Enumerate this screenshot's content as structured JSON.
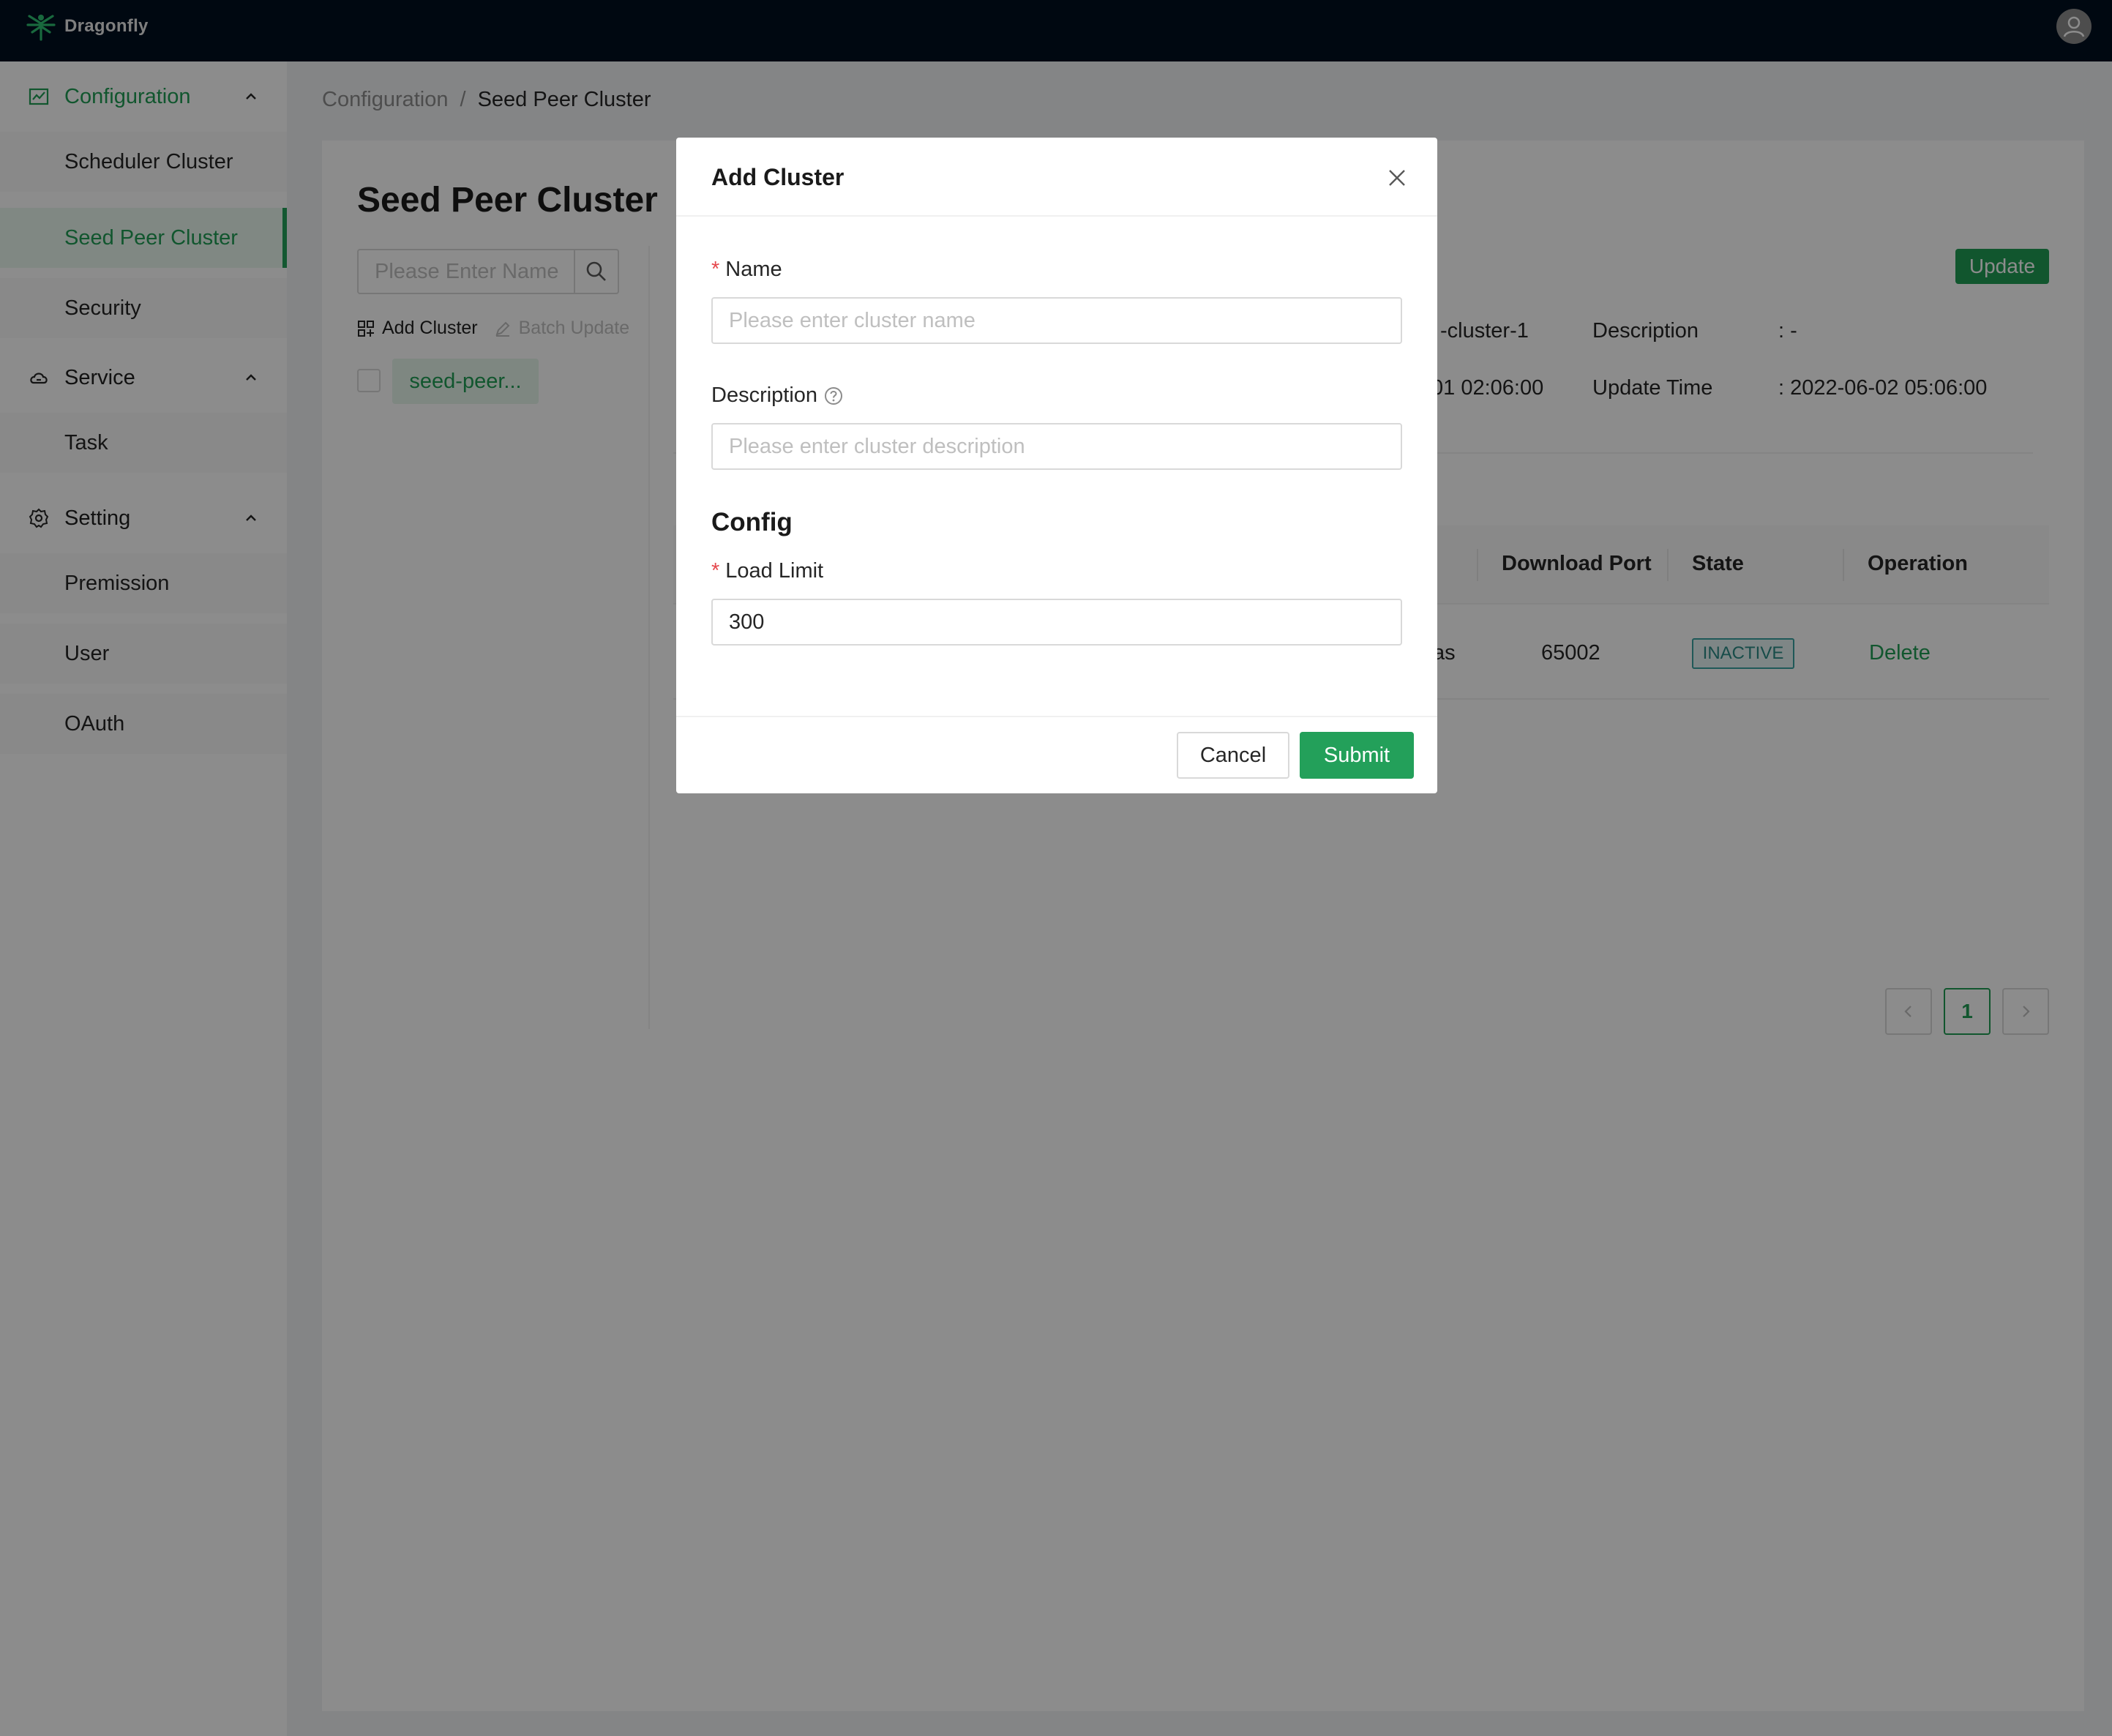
{
  "app": {
    "name": "Dragonfly"
  },
  "sidebar": {
    "groups": [
      {
        "label": "Configuration",
        "icon": "chart-icon",
        "items": [
          "Scheduler Cluster",
          "Seed Peer Cluster",
          "Security"
        ]
      },
      {
        "label": "Service",
        "icon": "cloud-icon",
        "items": [
          "Task"
        ]
      },
      {
        "label": "Setting",
        "icon": "gear-icon",
        "items": [
          "Premission",
          "User",
          "OAuth"
        ]
      }
    ],
    "active_item": "Seed Peer Cluster"
  },
  "breadcrumb": {
    "parent": "Configuration",
    "separator": "/",
    "current": "Seed Peer Cluster"
  },
  "page": {
    "title": "Seed Peer Cluster",
    "search_placeholder": "Please Enter Name",
    "add_cluster": "Add Cluster",
    "batch_update": "Batch Update",
    "cluster_tag": "seed-peer...",
    "update_button": "Update",
    "info": {
      "name_value": "-cluster-1",
      "description_label": "Description",
      "description_value": ":  -",
      "created_value": "01 02:06:00",
      "update_time_label": "Update Time",
      "update_time_value": ":  2022-06-02 05:06:00"
    },
    "table": {
      "columns": [
        "Download Port",
        "State",
        "Operation"
      ],
      "row": {
        "partial_cell": "as",
        "download_port": "65002",
        "state": "INACTIVE",
        "operation": "Delete"
      }
    },
    "pagination": {
      "current_page": "1"
    }
  },
  "modal": {
    "title": "Add Cluster",
    "name_label": "Name",
    "name_placeholder": "Please enter cluster name",
    "description_label": "Description",
    "description_placeholder": "Please enter cluster description",
    "config_title": "Config",
    "load_limit_label": "Load Limit",
    "load_limit_value": "300",
    "cancel": "Cancel",
    "submit": "Submit",
    "required_mark": "*"
  },
  "colors": {
    "accent": "#1f9d55",
    "topbar": "#011020",
    "required": "#e5484d"
  }
}
